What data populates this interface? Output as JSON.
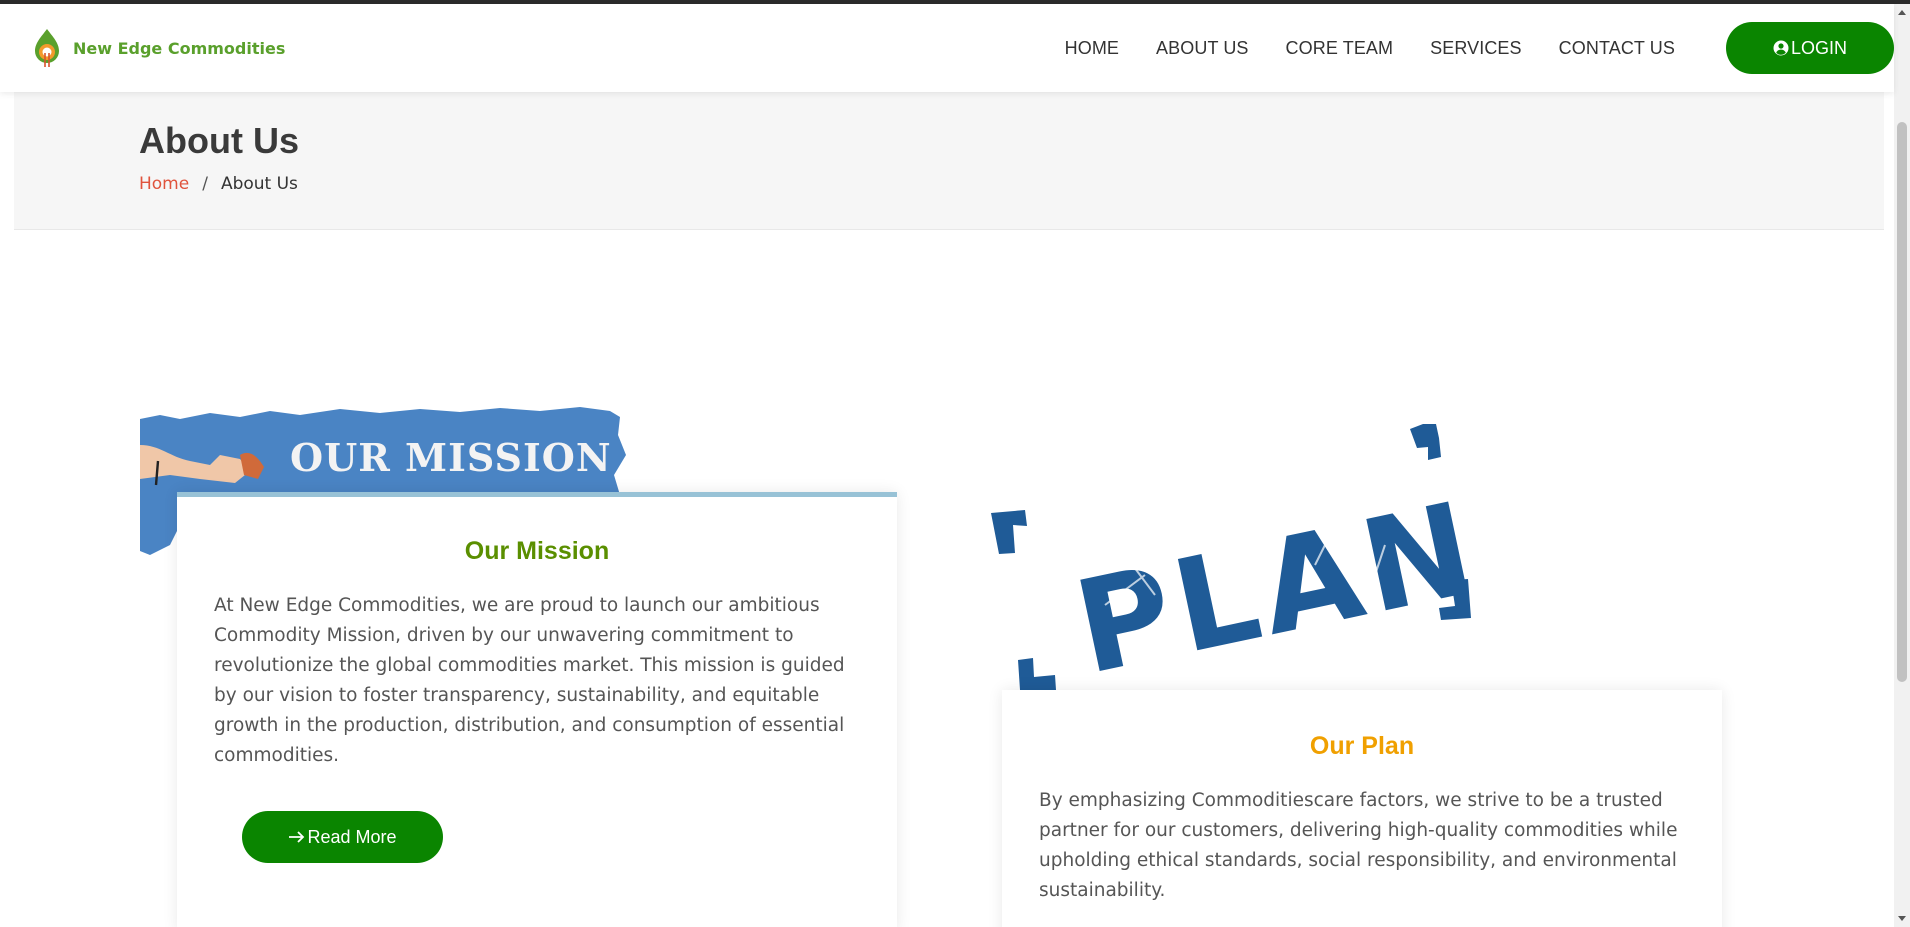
{
  "brand": {
    "name": "New Edge Commodities",
    "logo_icon": "drop-leaf-logo-icon",
    "color": "#5aa02c"
  },
  "nav": {
    "items": [
      {
        "label": "HOME"
      },
      {
        "label": "ABOUT US"
      },
      {
        "label": "CORE TEAM"
      },
      {
        "label": "SERVICES"
      },
      {
        "label": "CONTACT US"
      }
    ],
    "login_label": "LOGIN",
    "login_icon": "user-circle-icon"
  },
  "page_header": {
    "title": "About Us",
    "breadcrumb": {
      "home": "Home",
      "separator": "/",
      "current": "About Us"
    }
  },
  "mission": {
    "image_text": "OUR MISSION",
    "title": "Our Mission",
    "text": "At New Edge Commodities, we are proud to launch our ambitious Commodity Mission, driven by our unwavering commitment to revolutionize the global commodities market. This mission is guided by our vision to foster transparency, sustainability, and equitable growth in the production, distribution, and consumption of essential commodities.",
    "button_label": "Read More",
    "button_icon": "arrow-right-icon"
  },
  "plan": {
    "image_text": "PLAN",
    "title": "Our Plan",
    "text": "By emphasizing Commoditiescare factors, we strive to be a trusted partner for our customers, delivering high-quality commodities while upholding ethical standards, social responsibility, and environmental sustainability."
  },
  "colors": {
    "accent_green": "#0a8500",
    "mission_title": "#5a8f00",
    "plan_title": "#f0a000",
    "breadcrumb_link": "#e0533c",
    "plan_blue": "#1f5b97"
  }
}
